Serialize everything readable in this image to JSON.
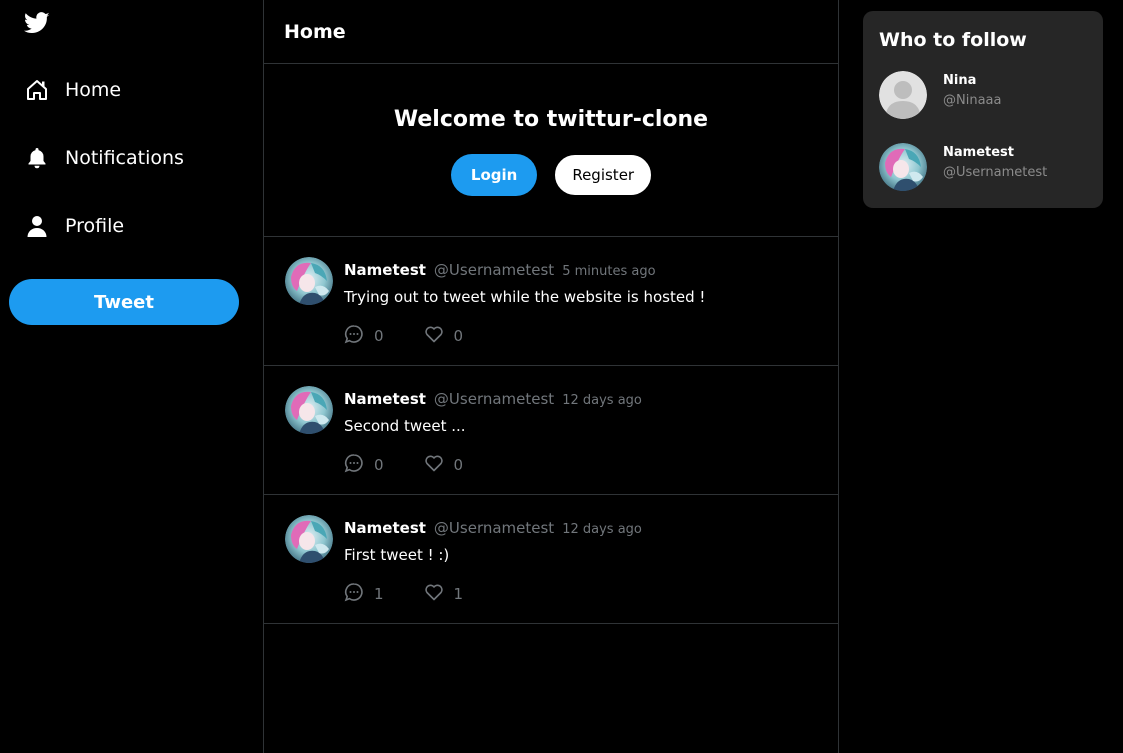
{
  "sidebar": {
    "logo_icon": "twitter-bird-icon",
    "nav": [
      {
        "label": "Home",
        "icon": "home-icon"
      },
      {
        "label": "Notifications",
        "icon": "bell-icon"
      },
      {
        "label": "Profile",
        "icon": "user-icon"
      }
    ],
    "tweet_button": "Tweet"
  },
  "main": {
    "title": "Home",
    "welcome": {
      "heading": "Welcome to twittur-clone",
      "login_label": "Login",
      "register_label": "Register"
    },
    "tweets": [
      {
        "name": "Nametest",
        "handle": "@Usernametest",
        "time": "5 minutes ago",
        "text": "Trying out to tweet while the website is hosted !",
        "replies": "0",
        "likes": "0"
      },
      {
        "name": "Nametest",
        "handle": "@Usernametest",
        "time": "12 days ago",
        "text": "Second tweet ...",
        "replies": "0",
        "likes": "0"
      },
      {
        "name": "Nametest",
        "handle": "@Usernametest",
        "time": "12 days ago",
        "text": "First tweet ! :)",
        "replies": "1",
        "likes": "1"
      }
    ]
  },
  "who_to_follow": {
    "title": "Who to follow",
    "users": [
      {
        "name": "Nina",
        "handle": "@Ninaaa",
        "avatar": "default-avatar"
      },
      {
        "name": "Nametest",
        "handle": "@Usernametest",
        "avatar": "anime-avatar"
      }
    ]
  },
  "colors": {
    "accent": "#1d9bf0",
    "background": "#000000",
    "card": "#262626",
    "muted": "#71767b",
    "border": "#2f3336"
  }
}
